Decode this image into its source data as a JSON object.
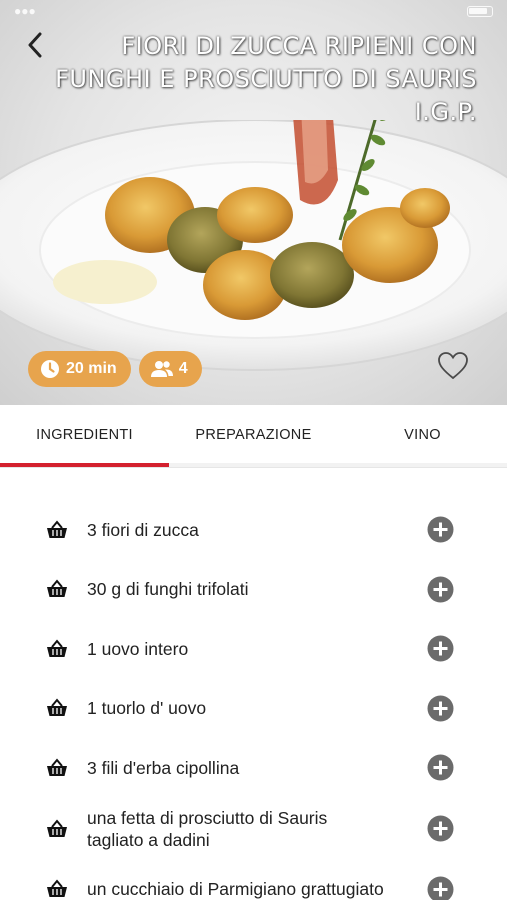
{
  "recipe": {
    "title": "FIORI DI ZUCCA RIPIENI  CON FUNGHI E PROSCIUTTO DI SAURIS I.G.P.",
    "time": "20 min",
    "servings": "4"
  },
  "tabs": [
    {
      "label": "INGREDIENTI",
      "active": true
    },
    {
      "label": "PREPARAZIONE",
      "active": false
    },
    {
      "label": "VINO",
      "active": false
    }
  ],
  "ingredients": [
    {
      "text": "3 fiori di  zucca"
    },
    {
      "text": "30 g di  funghi trifolati"
    },
    {
      "text": "1 uovo  intero"
    },
    {
      "text": "1 tuorlo  d' uovo"
    },
    {
      "text": "3 fili  d'erba cipollina"
    },
    {
      "text": "una fetta  di prosciutto di Sauris tagliato a dadini"
    },
    {
      "text": "un cucchiaio  di Parmigiano grattugiato"
    }
  ],
  "colors": {
    "accent_red": "#d3202e",
    "badge_orange": "#e7a44d",
    "icon_gray": "#6b6b6b"
  },
  "icons": {
    "back": "chevron-left-icon",
    "clock": "clock-icon",
    "people": "people-icon",
    "favorite": "heart-outline-icon",
    "basket": "basket-icon",
    "add": "plus-circle-icon"
  }
}
